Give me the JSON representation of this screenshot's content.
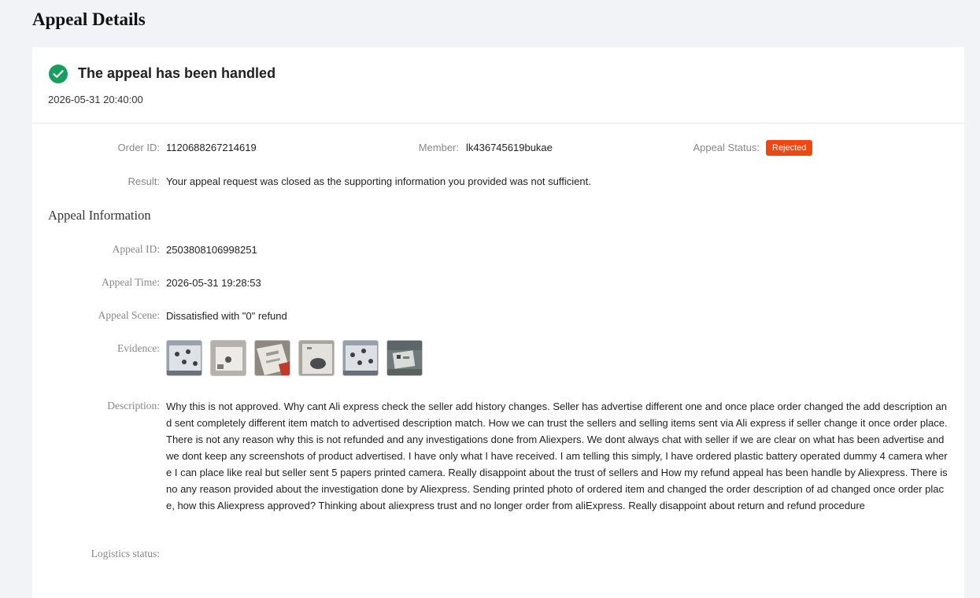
{
  "page": {
    "title": "Appeal Details"
  },
  "status": {
    "title": "The appeal has been handled",
    "time": "2026-05-31 20:40:00",
    "icon": "check-circle-icon",
    "color": "#17a05d"
  },
  "summary": {
    "order_id_label": "Order ID:",
    "order_id": "1120688267214619",
    "member_label": "Member:",
    "member": "lk436745619bukae",
    "appeal_status_label": "Appeal Status:",
    "appeal_status": "Rejected",
    "appeal_status_color": "#f0460f",
    "result_label": "Result:",
    "result": "Your appeal request was closed as the supporting information you provided was not sufficient."
  },
  "appeal": {
    "section_title": "Appeal Information",
    "id_label": "Appeal ID:",
    "id": "2503808106998251",
    "time_label": "Appeal Time:",
    "time": "2026-05-31 19:28:53",
    "scene_label": "Appeal Scene:",
    "scene": "Dissatisfied with \"0\" refund",
    "evidence_label": "Evidence:",
    "evidence": [
      {
        "name": "evidence-photo-1",
        "icon": "photo-thumbnail"
      },
      {
        "name": "evidence-photo-2",
        "icon": "photo-thumbnail"
      },
      {
        "name": "evidence-photo-3",
        "icon": "photo-thumbnail"
      },
      {
        "name": "evidence-photo-4",
        "icon": "photo-thumbnail"
      },
      {
        "name": "evidence-photo-5",
        "icon": "photo-thumbnail"
      },
      {
        "name": "evidence-photo-6",
        "icon": "photo-thumbnail"
      }
    ],
    "description_label": "Description:",
    "description": "Why this is not approved. Why cant Ali express check the seller add history changes. Seller has advertise different one and once place order changed the add description and sent completely different item match to advertised description match. How we can trust the sellers and selling items sent via Ali express if seller change it once order place. There is not any reason why this is not refunded and any investigations done from Aliexpers. We dont always chat with seller if we are clear on what has been advertise and we dont keep any screenshots of product advertised. I have only what I have received. I am telling this simply, I have ordered plastic battery operated dummy 4 camera where I can place like real but seller sent 5 papers printed camera. Really disappoint about the trust of sellers and How my refund appeal has been handle by Aliexpress. There is no any reason provided about the investigation done by Aliexpress. Sending printed photo of ordered item and changed the order description of ad changed once order place, how this Aliexpress approved? Thinking about aliexpress trust and no longer order from aliExpress. Really disappoint about return and refund procedure",
    "logistics_label": "Logistics status:",
    "logistics": ""
  }
}
